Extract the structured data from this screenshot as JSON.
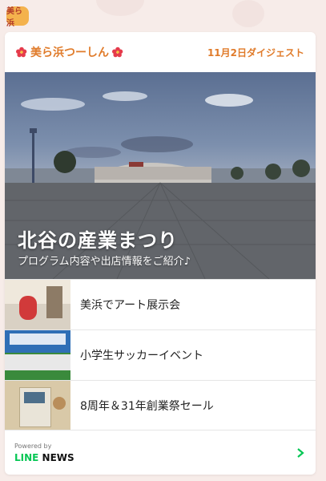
{
  "logo_text": "美ら浜",
  "header": {
    "brand": "美ら浜つーしん",
    "digest": "11月2日ダイジェスト"
  },
  "hero": {
    "title": "北谷の産業まつり",
    "subtitle": "プログラム内容や出店情報をご紹介♪"
  },
  "items": [
    {
      "label": "美浜でアート展示会"
    },
    {
      "label": "小学生サッカーイベント"
    },
    {
      "label": "8周年＆31年創業祭セール"
    }
  ],
  "footer": {
    "powered_by": "Powered by",
    "line": "LINE",
    "news": "NEWS"
  },
  "colors": {
    "accent": "#e07b2a",
    "line_green": "#06c755"
  }
}
